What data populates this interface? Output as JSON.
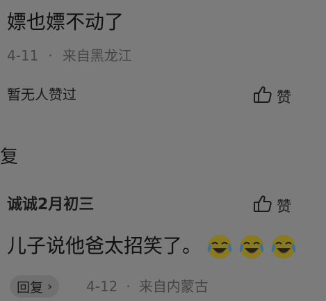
{
  "comment": {
    "text": "嫖也嫖不动了",
    "date": "4-11",
    "separator": "·",
    "location": "来自黑龙江",
    "likes_text": "暂无人赞过",
    "like_label": "赞"
  },
  "reply_section": {
    "header": "复"
  },
  "reply": {
    "username": "诚诚2月初三",
    "like_label": "赞",
    "text": "儿子说他爸太招笑了。",
    "emoji_count": 3,
    "emoji_name": "laugh-cry-emoji",
    "reply_button_label": "回复",
    "reply_button_chevron": "›",
    "date": "4-12",
    "separator": "·",
    "location": "来自内蒙古"
  }
}
